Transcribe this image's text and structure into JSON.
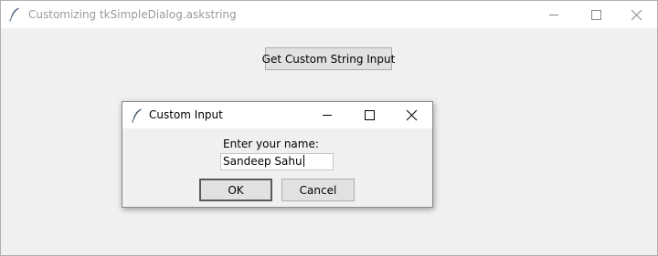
{
  "main_window": {
    "title": "Customizing tkSimpleDialog.askstring",
    "icon": "tk-feather-icon",
    "controls": {
      "minimize_icon": "minimize-icon",
      "maximize_icon": "maximize-icon",
      "close_icon": "close-icon"
    },
    "button_label": "Get Custom String Input"
  },
  "dialog": {
    "title": "Custom Input",
    "icon": "tk-feather-icon",
    "prompt": "Enter your name:",
    "entry_value": "Sandeep Sahu",
    "ok_label": "OK",
    "cancel_label": "Cancel"
  }
}
